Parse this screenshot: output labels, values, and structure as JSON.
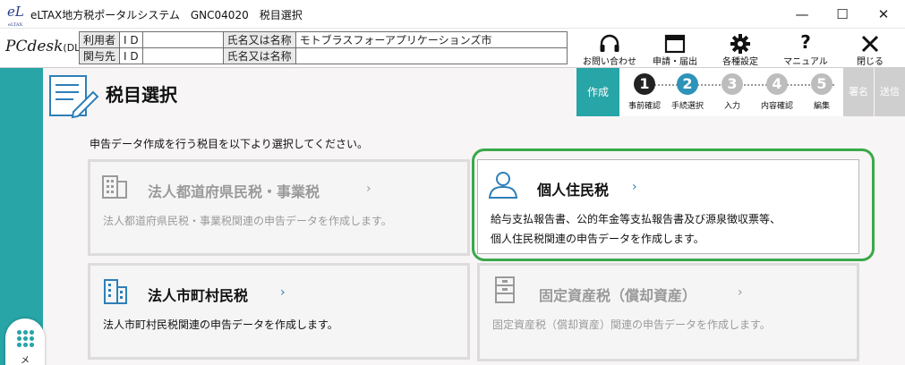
{
  "window": {
    "title": "eLTAX地方税ポータルシステム　GNC04020　税目選択",
    "logo_text": "eL",
    "logo_sub": "eLTAX",
    "minimize": "—",
    "maximize": "☐",
    "close": "✕"
  },
  "header": {
    "logo": "PCdesk",
    "logo_sub": "(DL版)",
    "user_table": {
      "row1": {
        "label": "利用者",
        "id_label": "I D",
        "id_value": "",
        "name_label": "氏名又は名称",
        "name_value": "モトブラスフォーアプリケーションズ市"
      },
      "row2": {
        "label": "関与先",
        "id_label": "I D",
        "id_value": "",
        "name_label": "氏名又は名称",
        "name_value": ""
      }
    },
    "buttons": [
      {
        "label": "お問い合わせ",
        "icon": "headset-icon"
      },
      {
        "label": "申請・届出",
        "icon": "window-icon"
      },
      {
        "label": "各種設定",
        "icon": "gear-icon"
      },
      {
        "label": "マニュアル",
        "icon": "question-icon"
      },
      {
        "label": "閉じる",
        "icon": "close-icon"
      }
    ]
  },
  "page": {
    "title": "税目選択",
    "instruction": "申告データ作成を行う税目を以下より選択してください。"
  },
  "steps": {
    "active_tab": "作成",
    "items": [
      {
        "num": "1",
        "label": "事前確認",
        "state": "done"
      },
      {
        "num": "2",
        "label": "手続選択",
        "state": "current"
      },
      {
        "num": "3",
        "label": "入力",
        "state": "todo"
      },
      {
        "num": "4",
        "label": "内容確認",
        "state": "todo"
      },
      {
        "num": "5",
        "label": "編集",
        "state": "todo"
      }
    ],
    "tab_sign": "署名",
    "tab_send": "送信"
  },
  "cards": {
    "corp_pref": {
      "title": "法人都道府県民税・事業税",
      "chevron": "›",
      "desc": "法人都道府県民税・事業税関連の申告データを作成します。",
      "enabled": false
    },
    "individual": {
      "title": "個人住民税",
      "chevron": "›",
      "desc1": "給与支払報告書、公的年金等支払報告書及び源泉徴収票等、",
      "desc2": "個人住民税関連の申告データを作成します。",
      "enabled": true
    },
    "corp_muni": {
      "title": "法人市町村民税",
      "chevron": "›",
      "desc": "法人市町村民税関連の申告データを作成します。",
      "enabled": true
    },
    "fixed_asset": {
      "title": "固定資産税（償却資産）",
      "chevron": "›",
      "desc": "固定資産税（償却資産）関連の申告データを作成します。",
      "enabled": false
    }
  },
  "menu": {
    "label": "メ"
  },
  "colors": {
    "teal": "#27a5a7",
    "step_current": "#2e93b8",
    "highlight": "#3aa84a",
    "link_blue": "#2e7fb8"
  }
}
